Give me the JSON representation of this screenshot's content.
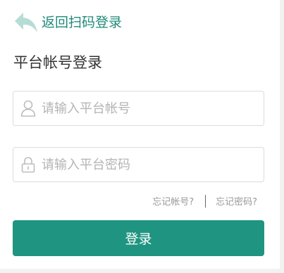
{
  "back": {
    "label": "返回扫码登录",
    "icon": "back-arrow-icon"
  },
  "title": "平台帐号登录",
  "account": {
    "placeholder": "请输入平台帐号",
    "value": "",
    "icon": "user-icon"
  },
  "password": {
    "placeholder": "请输入平台密码",
    "value": "",
    "icon": "lock-icon"
  },
  "links": {
    "forgot_account": "忘记帐号?",
    "forgot_password": "忘记密码?"
  },
  "login_button": "登录",
  "colors": {
    "accent": "#1f9480",
    "back_text": "#1f8a7a",
    "icon_light": "#b7dcd6"
  }
}
